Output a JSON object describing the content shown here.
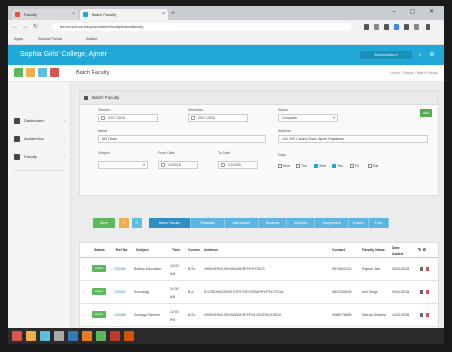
{
  "browser": {
    "tabs": [
      {
        "label": "Faculty",
        "close": "×"
      },
      {
        "label": "Batch Faculty",
        "close": "×"
      }
    ],
    "new_tab": "+",
    "window_controls": "– ▢ ✕",
    "url": "demo.school.edupro/admin/faculty/batchfaculty",
    "bookmarks": [
      "Apps",
      "School Portal",
      "Admin"
    ]
  },
  "app": {
    "title": "Sophia Girls' College, Ajmer",
    "user": "Administrator ▾",
    "page_title": "Batch Faculty",
    "breadcrumb": "Home / Faculty / Batch Faculty",
    "colors": {
      "header": "#20a8d8",
      "success": "#5cb85c",
      "link": "#2a7ab0"
    }
  },
  "sidebar": {
    "items": [
      {
        "label": "Dashboard",
        "icon": "home-icon"
      },
      {
        "label": "Academics",
        "icon": "book-icon"
      },
      {
        "label": "Faculty",
        "icon": "users-icon"
      }
    ]
  },
  "panel": {
    "title": "Batch Faculty",
    "new_button": "Add",
    "fields": {
      "session_label": "Session",
      "session_value": "2017-2018",
      "semester_label": "Semester",
      "semester_value": "2017-2018",
      "status_label": "Status",
      "status_value": "Complete",
      "name_label": "Name",
      "name_value": "AR Tiwari",
      "address_label": "Address",
      "address_value": "104 JSS Colony Road, Ajmer Rajasthan",
      "subject_label": "Subject",
      "from_label": "From Date",
      "from_value": "12/2018",
      "to_label": "To Date",
      "to_value": "12/2018",
      "days_label": "Days",
      "days": [
        "Mon",
        "Tue",
        "Wed",
        "Thu",
        "Fri",
        "Sat"
      ]
    }
  },
  "actions": {
    "save": "Save",
    "orange": "✎",
    "blue": "⟳",
    "strip": [
      "Batch Faculty",
      "Timetable",
      "Attendance",
      "Students",
      "Subjects",
      "Assignment",
      "Exams",
      "Fees"
    ]
  },
  "table": {
    "headers": [
      "Status",
      "Ref No.",
      "Subject",
      "Time",
      "Course",
      "Address",
      "Contact",
      "Faculty Name",
      "Date Added"
    ],
    "rows": [
      {
        "status": "Active",
        "ref": "123456",
        "subject": "Botany Education",
        "time": "10:00 AM",
        "course": "B.Sc",
        "address": "HINDI/ENGLISH/SANSKRIT/PHYSICS",
        "contact": "9876543210",
        "faculty": "Rajesh Jain",
        "date": "08/11/2018"
      },
      {
        "status": "Active",
        "ref": "123457",
        "subject": "Sociology",
        "time": "11:00 AM",
        "course": "B.A",
        "address": "ECONOMICS/HISTORY/GEOGRAPHY/POLITICAL",
        "contact": "9812345678",
        "faculty": "Anil Singh",
        "date": "09/11/2018"
      },
      {
        "status": "Active",
        "ref": "123458",
        "subject": "Zoology Science",
        "time": "12:00 PM",
        "course": "B.Sc",
        "address": "HINDI/ENGLISH/SANSKRIT/POL/SCIENCE/EDU",
        "contact": "9988776655",
        "faculty": "Meena Sharma",
        "date": "10/11/2018"
      }
    ]
  },
  "taskbar": {
    "colors": [
      "#d9534f",
      "#f0ad4e",
      "#5bc0de",
      "#aaa",
      "#337ab7",
      "#e67e22",
      "#5cb85c",
      "#c0392b",
      "#d35400"
    ]
  }
}
